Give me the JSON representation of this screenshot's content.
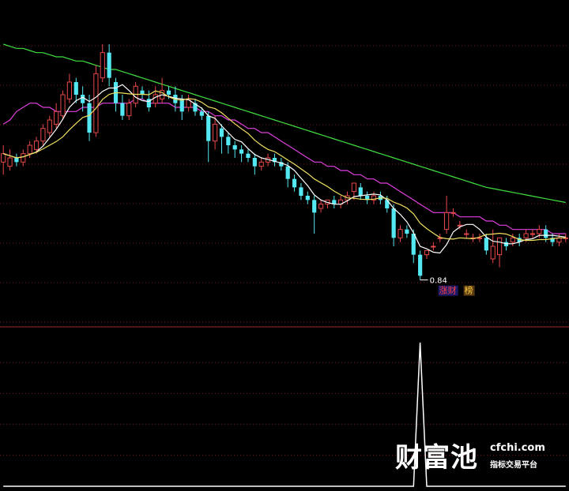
{
  "chart_data": [
    {
      "type": "candlestick",
      "x_count": 86,
      "ylim": [
        0.7,
        1.45
      ],
      "annotations": {
        "low_label": "0.84",
        "tag_one": "涨财",
        "tag_two": "榜"
      },
      "colors": {
        "up": "#e8484a",
        "down": "#54e8f2",
        "ma_fast": "#ffffff",
        "ma_mid": "#f0e060",
        "ma_slow": "#e040e0",
        "ma_long": "#40e040",
        "grid": "#7a1c1c"
      },
      "candles": [
        [
          1.08,
          1.1,
          1.05,
          1.12
        ],
        [
          1.07,
          1.09,
          1.06,
          1.11
        ],
        [
          1.09,
          1.08,
          1.07,
          1.1
        ],
        [
          1.08,
          1.1,
          1.07,
          1.11
        ],
        [
          1.1,
          1.12,
          1.09,
          1.13
        ],
        [
          1.11,
          1.13,
          1.1,
          1.14
        ],
        [
          1.13,
          1.16,
          1.12,
          1.17
        ],
        [
          1.15,
          1.18,
          1.14,
          1.19
        ],
        [
          1.17,
          1.2,
          1.16,
          1.22
        ],
        [
          1.19,
          1.24,
          1.18,
          1.25
        ],
        [
          1.23,
          1.27,
          1.22,
          1.29
        ],
        [
          1.27,
          1.24,
          1.22,
          1.28
        ],
        [
          1.24,
          1.22,
          1.2,
          1.26
        ],
        [
          1.22,
          1.15,
          1.13,
          1.24
        ],
        [
          1.15,
          1.29,
          1.14,
          1.31
        ],
        [
          1.28,
          1.34,
          1.27,
          1.36
        ],
        [
          1.34,
          1.28,
          1.26,
          1.36
        ],
        [
          1.27,
          1.22,
          1.2,
          1.28
        ],
        [
          1.22,
          1.19,
          1.18,
          1.24
        ],
        [
          1.19,
          1.22,
          1.18,
          1.23
        ],
        [
          1.22,
          1.26,
          1.21,
          1.27
        ],
        [
          1.25,
          1.24,
          1.23,
          1.26
        ],
        [
          1.23,
          1.21,
          1.2,
          1.25
        ],
        [
          1.22,
          1.24,
          1.21,
          1.26
        ],
        [
          1.23,
          1.25,
          1.22,
          1.28
        ],
        [
          1.25,
          1.24,
          1.23,
          1.26
        ],
        [
          1.24,
          1.22,
          1.2,
          1.26
        ],
        [
          1.23,
          1.2,
          1.18,
          1.24
        ],
        [
          1.21,
          1.23,
          1.2,
          1.24
        ],
        [
          1.22,
          1.2,
          1.19,
          1.23
        ],
        [
          1.2,
          1.19,
          1.18,
          1.21
        ],
        [
          1.19,
          1.13,
          1.08,
          1.2
        ],
        [
          1.13,
          1.17,
          1.11,
          1.19
        ],
        [
          1.16,
          1.14,
          1.1,
          1.17
        ],
        [
          1.14,
          1.12,
          1.1,
          1.15
        ],
        [
          1.12,
          1.11,
          1.09,
          1.13
        ],
        [
          1.11,
          1.1,
          1.08,
          1.12
        ],
        [
          1.1,
          1.09,
          1.08,
          1.11
        ],
        [
          1.09,
          1.07,
          1.05,
          1.1
        ],
        [
          1.07,
          1.08,
          1.06,
          1.09
        ],
        [
          1.08,
          1.09,
          1.07,
          1.1
        ],
        [
          1.09,
          1.08,
          1.07,
          1.1
        ],
        [
          1.08,
          1.07,
          1.06,
          1.09
        ],
        [
          1.07,
          1.04,
          1.02,
          1.08
        ],
        [
          1.04,
          1.02,
          1.01,
          1.05
        ],
        [
          1.02,
          1.0,
          0.99,
          1.03
        ],
        [
          1.0,
          0.99,
          0.98,
          1.01
        ],
        [
          0.99,
          0.96,
          0.91,
          1.0
        ],
        [
          0.97,
          0.98,
          0.96,
          0.99
        ],
        [
          0.98,
          0.99,
          0.97,
          0.99
        ],
        [
          0.99,
          0.98,
          0.97,
          1.0
        ],
        [
          0.98,
          0.99,
          0.97,
          1.0
        ],
        [
          0.99,
          1.0,
          0.98,
          1.01
        ],
        [
          1.01,
          1.03,
          0.99,
          1.03
        ],
        [
          1.02,
          1.0,
          0.99,
          1.03
        ],
        [
          1.0,
          0.99,
          0.98,
          1.01
        ],
        [
          0.99,
          1.0,
          0.98,
          1.01
        ],
        [
          1.0,
          0.99,
          0.98,
          1.01
        ],
        [
          0.99,
          0.97,
          0.96,
          1.0
        ],
        [
          0.97,
          0.9,
          0.88,
          0.98
        ],
        [
          0.9,
          0.92,
          0.89,
          0.93
        ],
        [
          0.92,
          0.91,
          0.9,
          0.93
        ],
        [
          0.91,
          0.86,
          0.84,
          0.92
        ],
        [
          0.86,
          0.81,
          0.8,
          0.87
        ],
        [
          0.86,
          0.87,
          0.85,
          0.87
        ],
        [
          0.88,
          0.88,
          0.87,
          0.89
        ],
        [
          0.9,
          0.9,
          0.89,
          0.91
        ],
        [
          0.92,
          0.96,
          0.91,
          1.0
        ],
        [
          0.96,
          0.96,
          0.95,
          0.97
        ],
        [
          0.93,
          0.93,
          0.92,
          0.94
        ],
        [
          0.91,
          0.91,
          0.9,
          0.92
        ],
        [
          0.9,
          0.9,
          0.89,
          0.91
        ],
        [
          0.9,
          0.9,
          0.89,
          0.91
        ],
        [
          0.9,
          0.87,
          0.86,
          0.91
        ],
        [
          0.85,
          0.88,
          0.84,
          0.92
        ],
        [
          0.86,
          0.9,
          0.83,
          0.9
        ],
        [
          0.89,
          0.88,
          0.87,
          0.9
        ],
        [
          0.89,
          0.9,
          0.88,
          0.91
        ],
        [
          0.9,
          0.89,
          0.88,
          0.91
        ],
        [
          0.9,
          0.91,
          0.89,
          0.92
        ],
        [
          0.91,
          0.91,
          0.9,
          0.92
        ],
        [
          0.91,
          0.92,
          0.9,
          0.93
        ],
        [
          0.92,
          0.9,
          0.89,
          0.93
        ],
        [
          0.9,
          0.89,
          0.88,
          0.91
        ],
        [
          0.89,
          0.9,
          0.88,
          0.91
        ],
        [
          0.9,
          0.9,
          0.89,
          0.91
        ]
      ],
      "ma_slow": [
        1.17,
        1.18,
        1.2,
        1.21,
        1.22,
        1.22,
        1.21,
        1.21,
        1.2,
        1.2,
        1.2,
        1.2,
        1.21,
        1.21,
        1.21,
        1.22,
        1.22,
        1.22,
        1.22,
        1.22,
        1.23,
        1.23,
        1.22,
        1.22,
        1.22,
        1.22,
        1.21,
        1.21,
        1.21,
        1.21,
        1.2,
        1.2,
        1.19,
        1.19,
        1.18,
        1.18,
        1.17,
        1.16,
        1.16,
        1.15,
        1.15,
        1.14,
        1.13,
        1.12,
        1.11,
        1.1,
        1.09,
        1.08,
        1.08,
        1.07,
        1.07,
        1.06,
        1.06,
        1.05,
        1.05,
        1.04,
        1.04,
        1.03,
        1.03,
        1.02,
        1.01,
        1.0,
        0.99,
        0.98,
        0.97,
        0.96,
        0.96,
        0.96,
        0.96,
        0.95,
        0.95,
        0.95,
        0.95,
        0.94,
        0.94,
        0.93,
        0.93,
        0.92,
        0.92,
        0.92,
        0.92,
        0.92,
        0.92,
        0.91,
        0.91,
        0.91
      ],
      "ma_long": [
        1.36,
        1.355,
        1.35,
        1.35,
        1.345,
        1.34,
        1.34,
        1.335,
        1.33,
        1.33,
        1.325,
        1.32,
        1.32,
        1.315,
        1.31,
        1.305,
        1.3,
        1.3,
        1.295,
        1.29,
        1.285,
        1.28,
        1.275,
        1.27,
        1.265,
        1.26,
        1.255,
        1.25,
        1.245,
        1.24,
        1.235,
        1.23,
        1.225,
        1.22,
        1.215,
        1.21,
        1.205,
        1.2,
        1.195,
        1.19,
        1.185,
        1.18,
        1.175,
        1.17,
        1.165,
        1.16,
        1.155,
        1.15,
        1.145,
        1.14,
        1.135,
        1.13,
        1.125,
        1.12,
        1.115,
        1.11,
        1.105,
        1.1,
        1.095,
        1.09,
        1.085,
        1.08,
        1.075,
        1.07,
        1.065,
        1.06,
        1.055,
        1.05,
        1.045,
        1.04,
        1.035,
        1.03,
        1.025,
        1.02,
        1.017,
        1.014,
        1.011,
        1.008,
        1.005,
        1.002,
        0.999,
        0.996,
        0.993,
        0.99,
        0.987,
        0.984
      ]
    },
    {
      "type": "line",
      "values": [
        0,
        0,
        0,
        0,
        0,
        0,
        0,
        0,
        0,
        0,
        0,
        0,
        0,
        0,
        0,
        0,
        0,
        0,
        0,
        0,
        0,
        0,
        0,
        0,
        0,
        0,
        0,
        0,
        0,
        0,
        0,
        0,
        0,
        0,
        0,
        0,
        0,
        0,
        0,
        0,
        0,
        0,
        0,
        0,
        0,
        0,
        0,
        0,
        0,
        0,
        0,
        0,
        0,
        0,
        0,
        0,
        0,
        0,
        0,
        0,
        0,
        0,
        0,
        1,
        0,
        0,
        0,
        0,
        0,
        0,
        0,
        0,
        0,
        0,
        0,
        0,
        0,
        0,
        0,
        0,
        0,
        0,
        0,
        0,
        0,
        0
      ],
      "ylim": [
        0,
        1
      ]
    }
  ],
  "watermark": {
    "brand": "财富池",
    "url": "cfchi.com",
    "tagline": "指标交易平台"
  }
}
